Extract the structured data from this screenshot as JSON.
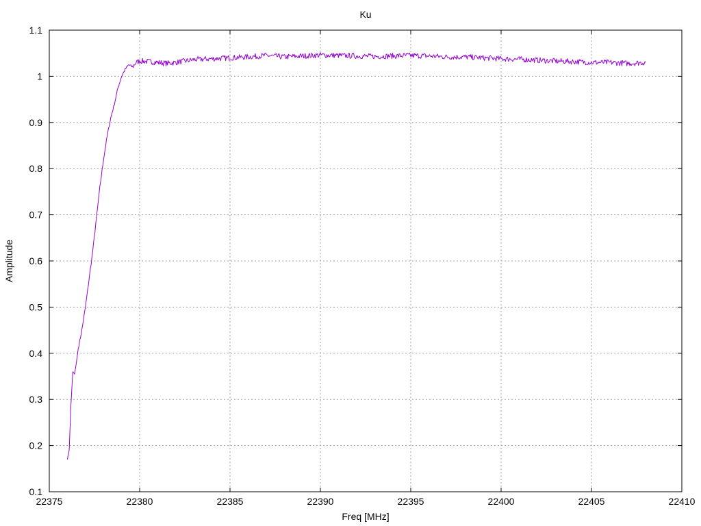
{
  "chart_data": {
    "type": "line",
    "title": "Ku",
    "xlabel": "Freq [MHz]",
    "ylabel": "Amplitude",
    "xlim": [
      22375,
      22410
    ],
    "ylim": [
      0.1,
      1.1
    ],
    "x_ticks": [
      "22375",
      "22380",
      "22385",
      "22390",
      "22395",
      "22400",
      "22405",
      "22410"
    ],
    "y_ticks": [
      "0.1",
      "0.2",
      "0.3",
      "0.4",
      "0.5",
      "0.6",
      "0.7",
      "0.8",
      "0.9",
      "1",
      "1.1"
    ],
    "grid": true,
    "series": [
      {
        "color": "#9400d3",
        "points": [
          [
            22376.0,
            0.17
          ],
          [
            22376.1,
            0.19
          ],
          [
            22376.2,
            0.29
          ],
          [
            22376.3,
            0.36
          ],
          [
            22376.4,
            0.355
          ],
          [
            22376.5,
            0.38
          ],
          [
            22376.6,
            0.41
          ],
          [
            22376.8,
            0.45
          ],
          [
            22377.0,
            0.5
          ],
          [
            22377.2,
            0.56
          ],
          [
            22377.4,
            0.62
          ],
          [
            22377.6,
            0.69
          ],
          [
            22377.8,
            0.76
          ],
          [
            22378.0,
            0.82
          ],
          [
            22378.2,
            0.87
          ],
          [
            22378.4,
            0.91
          ],
          [
            22378.6,
            0.94
          ],
          [
            22378.8,
            0.975
          ],
          [
            22379.0,
            1.0
          ],
          [
            22379.2,
            1.015
          ],
          [
            22379.4,
            1.025
          ],
          [
            22379.6,
            1.02
          ],
          [
            22379.8,
            1.03
          ],
          [
            22380.0,
            1.033
          ],
          [
            22380.5,
            1.032
          ],
          [
            22381.0,
            1.03
          ],
          [
            22381.5,
            1.028
          ],
          [
            22382.0,
            1.03
          ],
          [
            22383.0,
            1.036
          ],
          [
            22384.0,
            1.038
          ],
          [
            22385.0,
            1.04
          ],
          [
            22386.0,
            1.042
          ],
          [
            22387.0,
            1.045
          ],
          [
            22388.0,
            1.042
          ],
          [
            22389.0,
            1.044
          ],
          [
            22390.0,
            1.046
          ],
          [
            22391.0,
            1.045
          ],
          [
            22392.0,
            1.044
          ],
          [
            22393.0,
            1.043
          ],
          [
            22394.0,
            1.044
          ],
          [
            22395.0,
            1.045
          ],
          [
            22396.0,
            1.044
          ],
          [
            22397.0,
            1.042
          ],
          [
            22398.0,
            1.042
          ],
          [
            22399.0,
            1.04
          ],
          [
            22400.0,
            1.038
          ],
          [
            22401.0,
            1.037
          ],
          [
            22402.0,
            1.035
          ],
          [
            22403.0,
            1.033
          ],
          [
            22404.0,
            1.032
          ],
          [
            22405.0,
            1.03
          ],
          [
            22406.0,
            1.03
          ],
          [
            22407.0,
            1.028
          ],
          [
            22408.0,
            1.03
          ]
        ]
      }
    ]
  }
}
